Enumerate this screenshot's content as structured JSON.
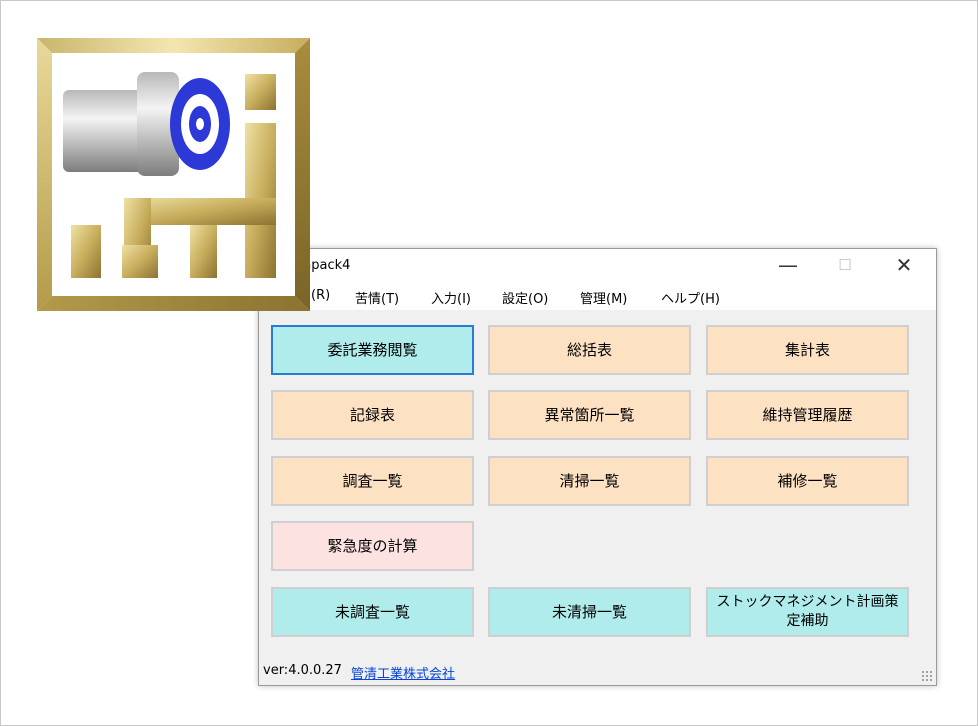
{
  "window": {
    "title_visible": "npack4",
    "controls": {
      "minimize": "—",
      "maximize": "☐",
      "close": "✕"
    }
  },
  "menu": {
    "items": [
      {
        "label": "(R)"
      },
      {
        "label": "苦情(T)"
      },
      {
        "label": "入力(I)"
      },
      {
        "label": "設定(O)"
      },
      {
        "label": "管理(M)"
      },
      {
        "label": "ヘルプ(H)"
      }
    ]
  },
  "buttons": {
    "itaku": "委託業務閲覧",
    "soukatsu": "総括表",
    "shukei": "集計表",
    "kiroku": "記録表",
    "ijou": "異常箇所一覧",
    "iji": "維持管理履歴",
    "chousa": "調査一覧",
    "seisou": "清掃一覧",
    "hoshuu": "補修一覧",
    "kinkyu": "緊急度の計算",
    "michousa": "未調査一覧",
    "miseisou": "未清掃一覧",
    "stock": "ストックマネジメント計画策定補助"
  },
  "status": {
    "version": "ver:4.0.0.27",
    "company": "管清工業株式会社"
  },
  "colors": {
    "cyan_button": "#b0ecec",
    "peach_button": "#fde1c3",
    "pink_button": "#fde2e2",
    "focus_border": "#2a7bd4",
    "link": "#0645d8"
  }
}
